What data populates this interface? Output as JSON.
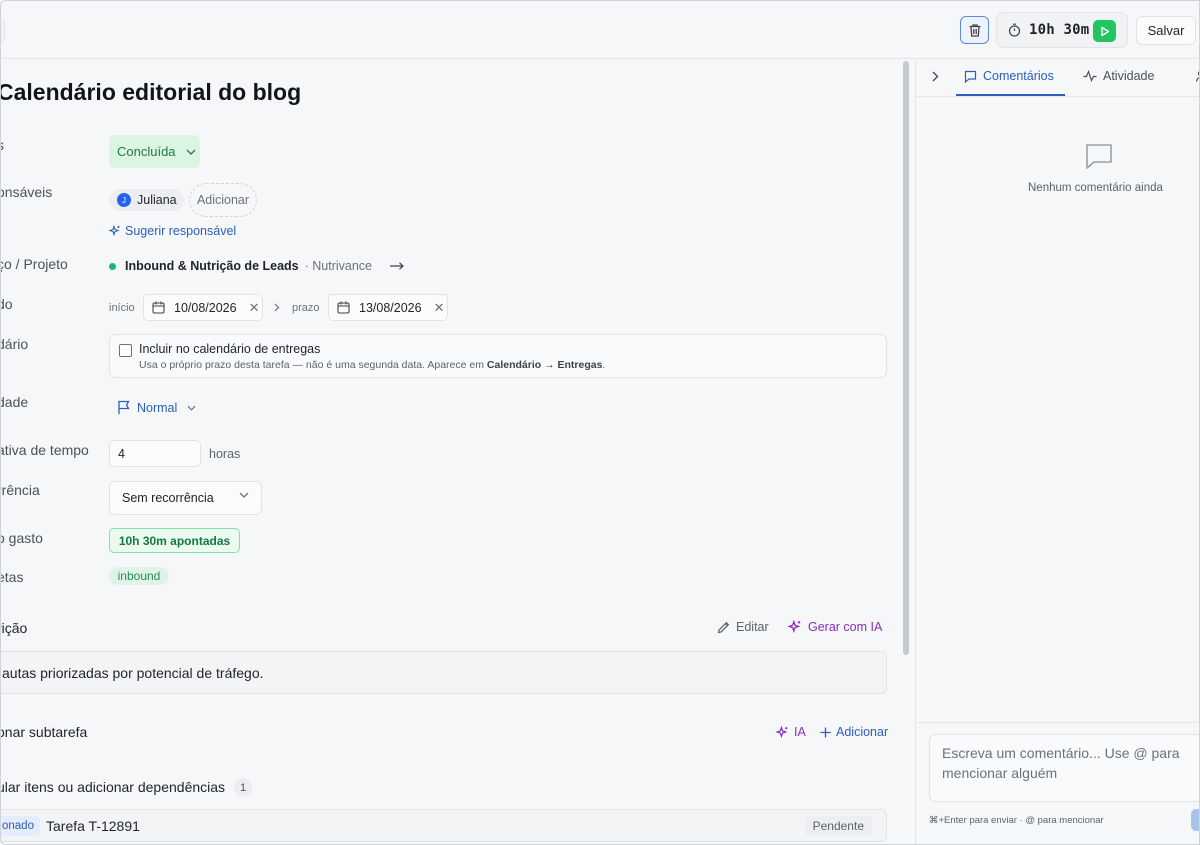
{
  "topbar": {
    "timer": "10h 30m",
    "save_label": "Salvar"
  },
  "task": {
    "title": "Calendário editorial do blog"
  },
  "fields": {
    "status_label": "s",
    "responsaveis_label": "onsáveis",
    "projeto_label": "ço / Projeto",
    "periodo_label": "do",
    "calendario_label": "dário",
    "prioridade_label": "dade",
    "estimativa_label": "ativa de tempo",
    "recorrencia_label": "rrência",
    "tempo_gasto_label": "o gasto",
    "etiquetas_label": "etas"
  },
  "status": {
    "value": "Concluída"
  },
  "assignees": {
    "items": [
      {
        "initial": "J",
        "name": "Juliana"
      }
    ],
    "add_label": "Adicionar",
    "suggest_label": "Sugerir responsável"
  },
  "project": {
    "name": "Inbound & Nutrição de Leads",
    "client": "· Nutrivance",
    "dot_color": "#22b573"
  },
  "dates": {
    "start_label": "início",
    "start_value": "10/08/2026",
    "due_label": "prazo",
    "due_value": "13/08/2026"
  },
  "calendar": {
    "checked": false,
    "title": "Incluir no calendário de entregas",
    "sub_prefix": "Usa o próprio prazo desta tarefa — não é uma segunda data. Aparece em ",
    "sub_bold": "Calendário → Entregas",
    "sub_suffix": "."
  },
  "priority": {
    "value": "Normal"
  },
  "estimate": {
    "value": "4",
    "unit": "horas"
  },
  "recurrence": {
    "value": "Sem recorrência"
  },
  "time_spent": {
    "value": "10h 30m apontadas"
  },
  "tags": [
    "inbound"
  ],
  "description": {
    "section_label": "rição",
    "edit_label": "Editar",
    "ai_label": "Gerar com IA",
    "text": "autas priorizadas por potencial de tráfego."
  },
  "subtasks": {
    "section_label": "onar subtarefa",
    "ia_label": "IA",
    "add_label": "Adicionar"
  },
  "dependencies": {
    "section_label": "ular itens ou adicionar dependências",
    "count": "1",
    "items": [
      {
        "type": "onado",
        "name": "Tarefa T-12891",
        "status": "Pendente"
      }
    ]
  },
  "right_panel": {
    "tabs": [
      {
        "label": "Comentários",
        "active": true,
        "icon": "comment-icon"
      },
      {
        "label": "Atividade",
        "active": false,
        "icon": "activity-icon"
      }
    ],
    "empty_text": "Nenhum comentário ainda",
    "composer_placeholder": "Escreva um comentário... Use @ para mencionar alguém",
    "hint": "⌘+Enter para enviar · @ para mencionar"
  },
  "colors": {
    "accent": "#2b5fb8",
    "success": "#22c55e",
    "ai": "#8a2fb9"
  }
}
